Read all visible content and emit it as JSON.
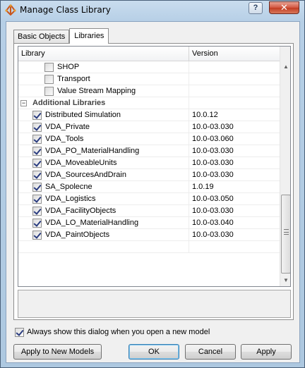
{
  "window": {
    "title": "Manage Class Library",
    "help_label": "?",
    "close_label": "✕"
  },
  "tabs": [
    {
      "label": "Basic Objects",
      "active": false
    },
    {
      "label": "Libraries",
      "active": true
    }
  ],
  "list": {
    "columns": {
      "library": "Library",
      "version": "Version"
    },
    "rows": [
      {
        "type": "item",
        "name": "SHOP",
        "version": "",
        "checked": false
      },
      {
        "type": "item",
        "name": "Transport",
        "version": "",
        "checked": false
      },
      {
        "type": "item",
        "name": "Value Stream Mapping",
        "version": "",
        "checked": false
      },
      {
        "type": "group",
        "name": "Additional Libraries",
        "toggle": "−"
      },
      {
        "type": "item",
        "name": "Distributed Simulation",
        "version": "10.0.12",
        "checked": true
      },
      {
        "type": "item",
        "name": "VDA_Private",
        "version": "10.0-03.030",
        "checked": true
      },
      {
        "type": "item",
        "name": "VDA_Tools",
        "version": "10.0-03.060",
        "checked": true
      },
      {
        "type": "item",
        "name": "VDA_PO_MaterialHandling",
        "version": "10.0-03.030",
        "checked": true
      },
      {
        "type": "item",
        "name": "VDA_MoveableUnits",
        "version": "10.0-03.030",
        "checked": true
      },
      {
        "type": "item",
        "name": "VDA_SourcesAndDrain",
        "version": "10.0-03.030",
        "checked": true
      },
      {
        "type": "item",
        "name": "SA_Spolecne",
        "version": "1.0.19",
        "checked": true
      },
      {
        "type": "item",
        "name": "VDA_Logistics",
        "version": "10.0-03.050",
        "checked": true
      },
      {
        "type": "item",
        "name": "VDA_FacilityObjects",
        "version": "10.0-03.030",
        "checked": true
      },
      {
        "type": "item",
        "name": "VDA_LO_MaterialHandling",
        "version": "10.0-03.040",
        "checked": true
      },
      {
        "type": "item",
        "name": "VDA_PaintObjects",
        "version": "10.0-03.030",
        "checked": true
      }
    ]
  },
  "options": {
    "always_show_label": "Always show this dialog when you open a new model",
    "always_show_checked": true
  },
  "buttons": {
    "apply_new": "Apply to New Models",
    "ok": "OK",
    "cancel": "Cancel",
    "apply": "Apply"
  }
}
